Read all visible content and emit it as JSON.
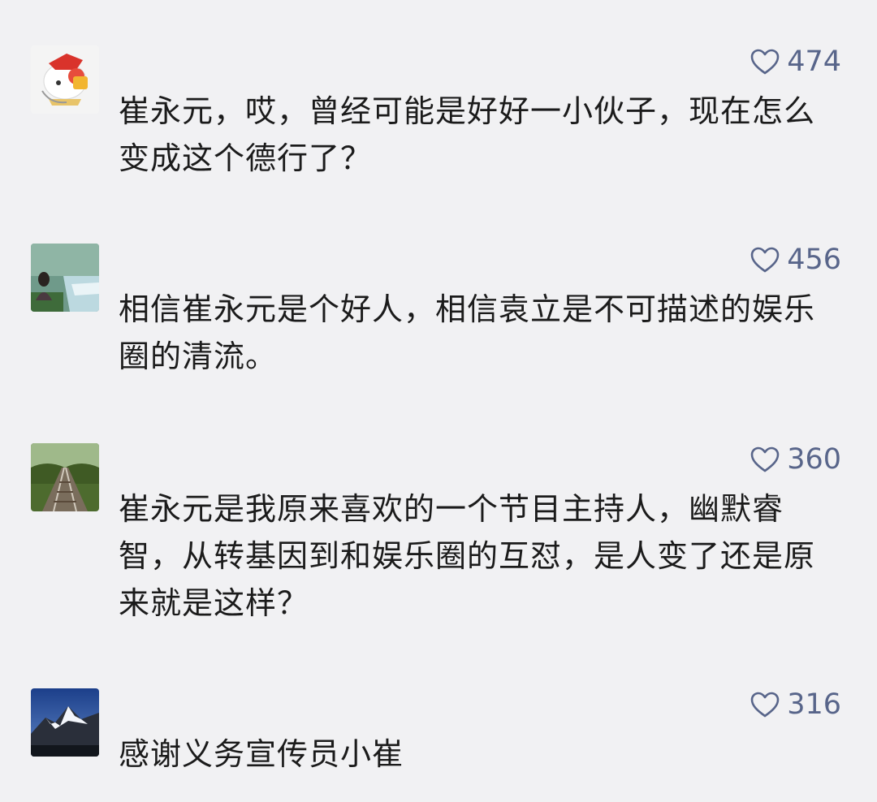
{
  "comments": [
    {
      "nickname": "",
      "avatar": "cartoon-avatar",
      "likes": "474",
      "text": "崔永元，哎，曾经可能是好好一小伙子，现在怎么变成这个德行了？"
    },
    {
      "nickname": "",
      "avatar": "waterfall-person-avatar",
      "likes": "456",
      "text": "相信崔永元是个好人，相信袁立是不可描述的娱乐圈的清流。"
    },
    {
      "nickname": "",
      "avatar": "railway-avatar",
      "likes": "360",
      "text": "崔永元是我原来喜欢的一个节目主持人，幽默睿智，从转基因到和娱乐圈的互怼，是人变了还是原来就是这样？"
    },
    {
      "nickname": "",
      "avatar": "snow-mountain-avatar",
      "likes": "316",
      "text": "感谢义务宣传员小崔"
    }
  ],
  "colors": {
    "background": "#f1f1f3",
    "like": "#58658a",
    "text": "#1b1b1b"
  },
  "icons": {
    "like": "heart-outline-icon"
  }
}
